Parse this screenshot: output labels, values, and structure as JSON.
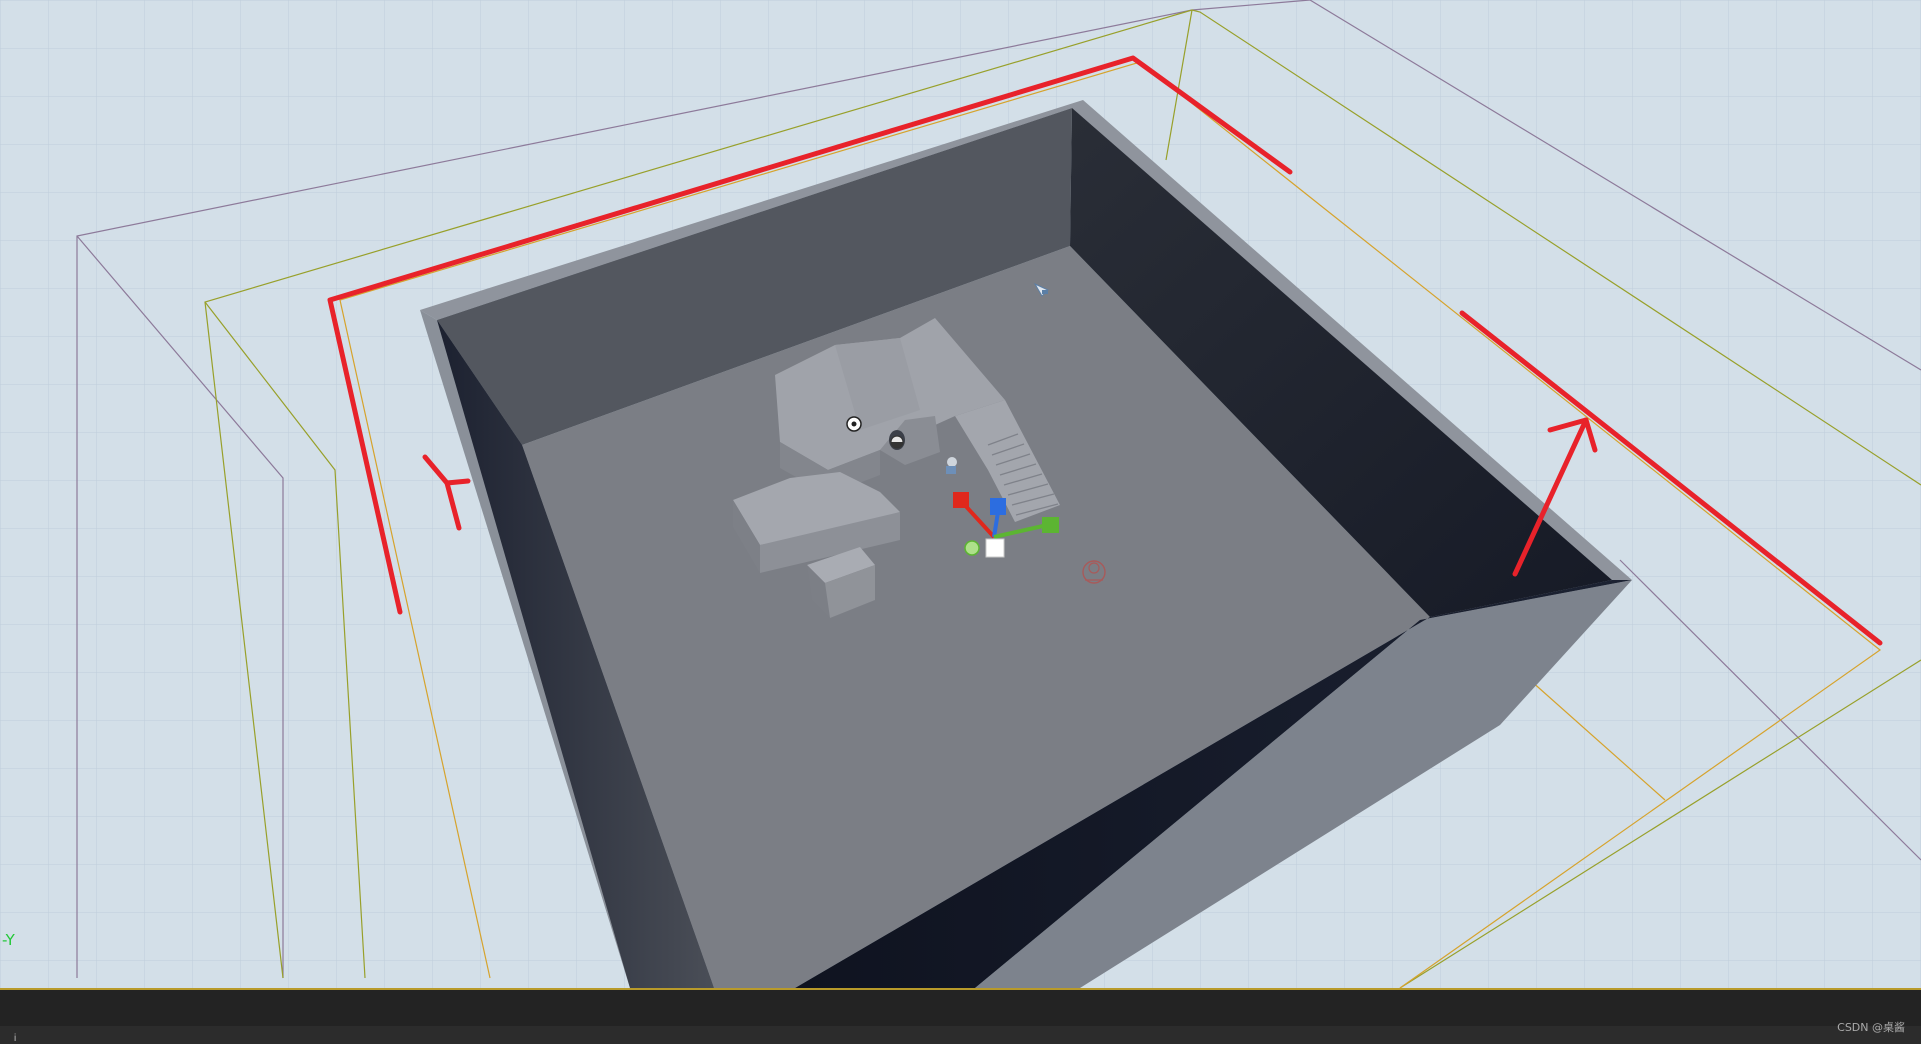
{
  "viewport": {
    "axis_label": "-Y",
    "grid_color": "#bccbd8",
    "floor_color": "#7b7e85",
    "inner_wall_color": "#50545c",
    "dark_wall_color": "#1f2330",
    "rim_color": "#8f949d",
    "outer_wall_color": "#7d838d",
    "bound_purple": "#8d7a9a",
    "bound_olive": "#98a02a",
    "bound_orange": "#d6a32c",
    "annotation_color": "#e8222a",
    "gizmo": {
      "x_color": "#e0281c",
      "y_color": "#5cb532",
      "z_color": "#2c6de0"
    }
  },
  "statusbar": {
    "glyph": "i"
  },
  "watermark": "CSDN @桌酱"
}
